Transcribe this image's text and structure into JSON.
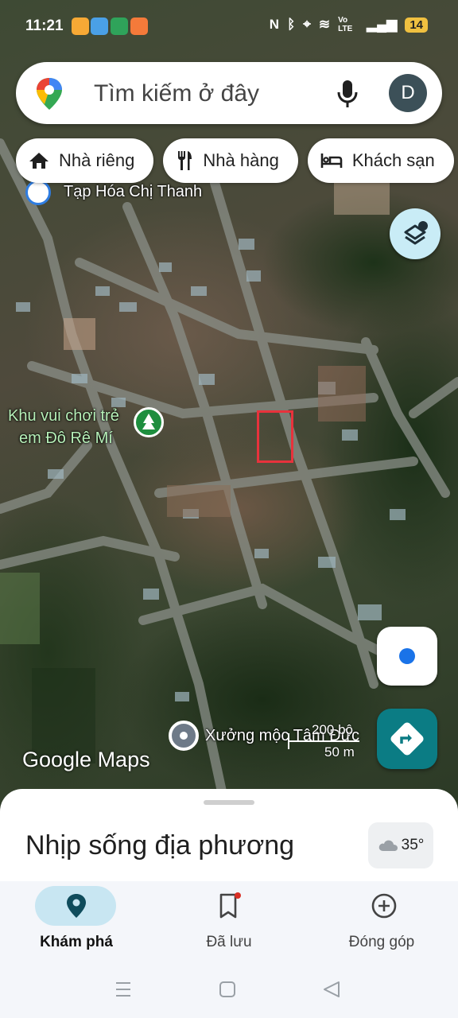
{
  "status_bar": {
    "time": "11:21",
    "lte": "Vo LTE",
    "battery": "14"
  },
  "search": {
    "placeholder": "Tìm kiếm ở đây",
    "avatar_letter": "D"
  },
  "chips": [
    {
      "label": "Nhà riêng",
      "icon": "home-icon"
    },
    {
      "label": "Nhà hàng",
      "icon": "restaurant-icon"
    },
    {
      "label": "Khách sạn",
      "icon": "hotel-icon"
    }
  ],
  "map": {
    "labels": {
      "store": "Tạp Hóa Chị Thanh",
      "park_line1": "Khu vui chơi trẻ",
      "park_line2": "em Đô Rê Mí",
      "workshop": "Xưởng mộc Tâm Đức"
    },
    "scale": {
      "top": "200 bộ",
      "bottom": "50 m"
    },
    "logo": "Google Maps"
  },
  "sheet": {
    "title": "Nhịp sống địa phương",
    "temperature": "35°"
  },
  "nav": {
    "explore": "Khám phá",
    "saved": "Đã lưu",
    "contribute": "Đóng góp"
  },
  "colors": {
    "accent": "#0b7c84",
    "location": "#1a73e8",
    "highlight": "#e8323c",
    "nav_active_pill": "#c8e6f2"
  }
}
